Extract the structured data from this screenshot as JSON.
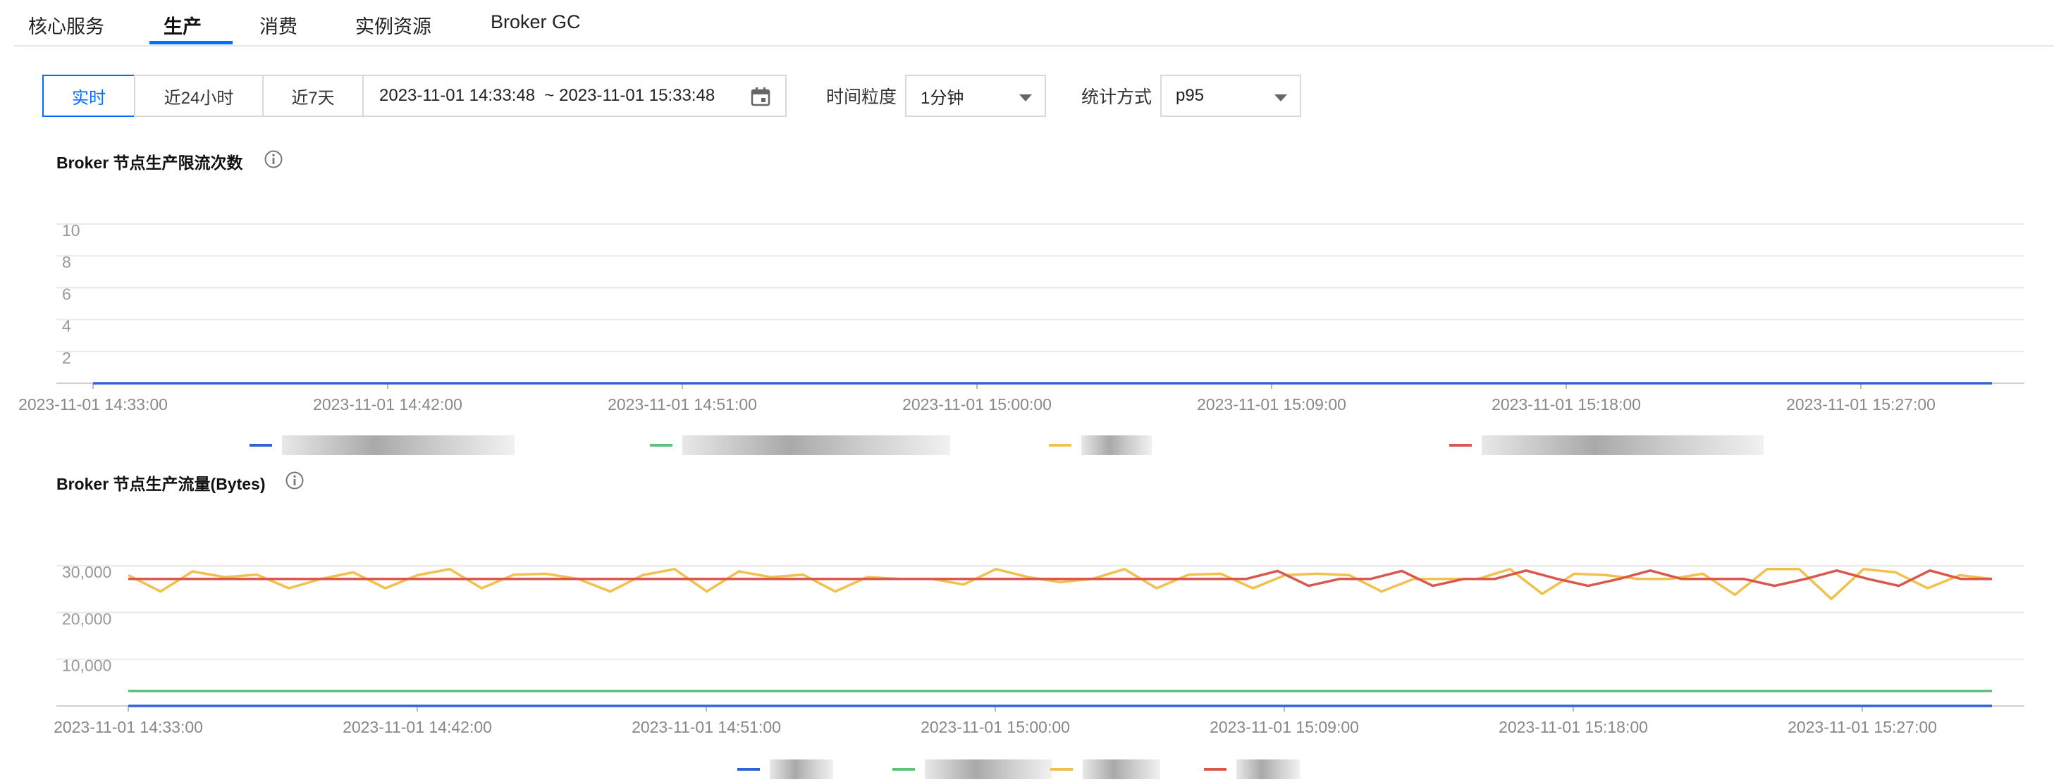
{
  "tabs": [
    {
      "label": "核心服务",
      "active": false
    },
    {
      "label": "生产",
      "active": true
    },
    {
      "label": "消费",
      "active": false
    },
    {
      "label": "实例资源",
      "active": false
    },
    {
      "label": "Broker GC",
      "active": false
    }
  ],
  "toolbar": {
    "ranges": [
      "实时",
      "近24小时",
      "近7天"
    ],
    "active_range": "实时",
    "date_range": "2023-11-01 14:33:48  ~ 2023-11-01 15:33:48",
    "granularity_label": "时间粒度",
    "granularity_value": "1分钟",
    "stat_label": "统计方式",
    "stat_value": "p95",
    "icons": {
      "calendar": "calendar-icon",
      "dropdown": "chevron-down-icon",
      "info": "info-icon"
    }
  },
  "colors": {
    "accent": "#006eff",
    "blue": "#2f63d6",
    "green": "#5ec17c",
    "yellow": "#f1c150",
    "red": "#d9574c"
  },
  "chart_data": [
    {
      "type": "line",
      "title": "Broker 节点生产限流次数",
      "x_ticks": [
        "2023-11-01 14:33:00",
        "2023-11-01 14:42:00",
        "2023-11-01 14:51:00",
        "2023-11-01 15:00:00",
        "2023-11-01 15:09:00",
        "2023-11-01 15:18:00",
        "2023-11-01 15:27:00"
      ],
      "y_ticks": [
        "2",
        "4",
        "6",
        "8",
        "10"
      ],
      "ylim": [
        0,
        10
      ],
      "grid": true,
      "legend_position": "bottom-center",
      "series": [
        {
          "color": "#2f63d6",
          "values": [
            0,
            0,
            0,
            0,
            0,
            0,
            0,
            0,
            0,
            0,
            0,
            0,
            0,
            0,
            0,
            0,
            0,
            0,
            0,
            0,
            0,
            0,
            0,
            0,
            0,
            0,
            0,
            0,
            0,
            0,
            0,
            0,
            0,
            0,
            0,
            0,
            0,
            0,
            0,
            0,
            0,
            0,
            0,
            0,
            0,
            0,
            0,
            0,
            0,
            0,
            0,
            0,
            0,
            0,
            0,
            0,
            0,
            0,
            0
          ]
        }
      ]
    },
    {
      "type": "line",
      "title": "Broker 节点生产流量(Bytes)",
      "x_ticks": [
        "2023-11-01 14:33:00",
        "2023-11-01 14:42:00",
        "2023-11-01 14:51:00",
        "2023-11-01 15:00:00",
        "2023-11-01 15:09:00",
        "2023-11-01 15:18:00",
        "2023-11-01 15:27:00"
      ],
      "y_ticks": [
        "10,000",
        "20,000",
        "30,000"
      ],
      "ylim": [
        0,
        35000
      ],
      "grid": true,
      "legend_position": "bottom-center",
      "series": [
        {
          "color": "#2f63d6",
          "values": [
            0,
            0,
            0,
            0,
            0,
            0,
            0,
            0,
            0,
            0,
            0,
            0,
            0,
            0,
            0,
            0,
            0,
            0,
            0,
            0,
            0,
            0,
            0,
            0,
            0,
            0,
            0,
            0,
            0,
            0,
            0,
            0,
            0,
            0,
            0,
            0,
            0,
            0,
            0,
            0,
            0,
            0,
            0,
            0,
            0,
            0,
            0,
            0,
            0,
            0,
            0,
            0,
            0,
            0,
            0,
            0,
            0,
            0,
            0
          ]
        },
        {
          "color": "#5ec17c",
          "values": [
            3200,
            3200,
            3200,
            3200,
            3200,
            3200,
            3200,
            3200,
            3200,
            3200,
            3200,
            3200,
            3200,
            3200,
            3200,
            3200,
            3200,
            3200,
            3200,
            3200,
            3200,
            3200,
            3200,
            3200,
            3200,
            3200,
            3200,
            3200,
            3200,
            3200,
            3200,
            3200,
            3200,
            3200,
            3200,
            3200,
            3200,
            3200,
            3200,
            3200,
            3200,
            3200,
            3200,
            3200,
            3200,
            3200,
            3200,
            3200,
            3200,
            3200,
            3200,
            3200,
            3200,
            3200,
            3200,
            3200,
            3200,
            3200,
            3200
          ]
        },
        {
          "color": "#f1c150",
          "values": [
            28000,
            24500,
            28800,
            27600,
            28100,
            25200,
            27200,
            28600,
            25200,
            28000,
            29300,
            25200,
            28100,
            28300,
            27200,
            24500,
            28000,
            29300,
            24500,
            28800,
            27600,
            28100,
            24500,
            27600,
            27200,
            27200,
            26000,
            29300,
            27600,
            26500,
            27200,
            29300,
            25200,
            28100,
            28300,
            25200,
            28000,
            28300,
            28000,
            24500,
            27200,
            27200,
            27200,
            29300,
            24000,
            28300,
            28000,
            27200,
            27200,
            28300,
            23800,
            29300,
            29300,
            22900,
            29300,
            28600,
            25200,
            28000,
            27200
          ]
        },
        {
          "color": "#d9574c",
          "values": [
            27200,
            27200,
            27200,
            27200,
            27200,
            27200,
            27200,
            27200,
            27200,
            27200,
            27200,
            27200,
            27200,
            27200,
            27200,
            27200,
            27200,
            27200,
            27200,
            27200,
            27200,
            27200,
            27200,
            27200,
            27200,
            27200,
            27200,
            27200,
            27200,
            27200,
            27200,
            27200,
            27200,
            27200,
            27200,
            27200,
            27200,
            28900,
            25700,
            27200,
            27200,
            28900,
            25700,
            27200,
            27200,
            29000,
            27200,
            25700,
            27200,
            29000,
            27200,
            27200,
            27200,
            25700,
            27200,
            29000,
            27200,
            25700,
            29000,
            27200,
            27200
          ]
        }
      ]
    }
  ]
}
